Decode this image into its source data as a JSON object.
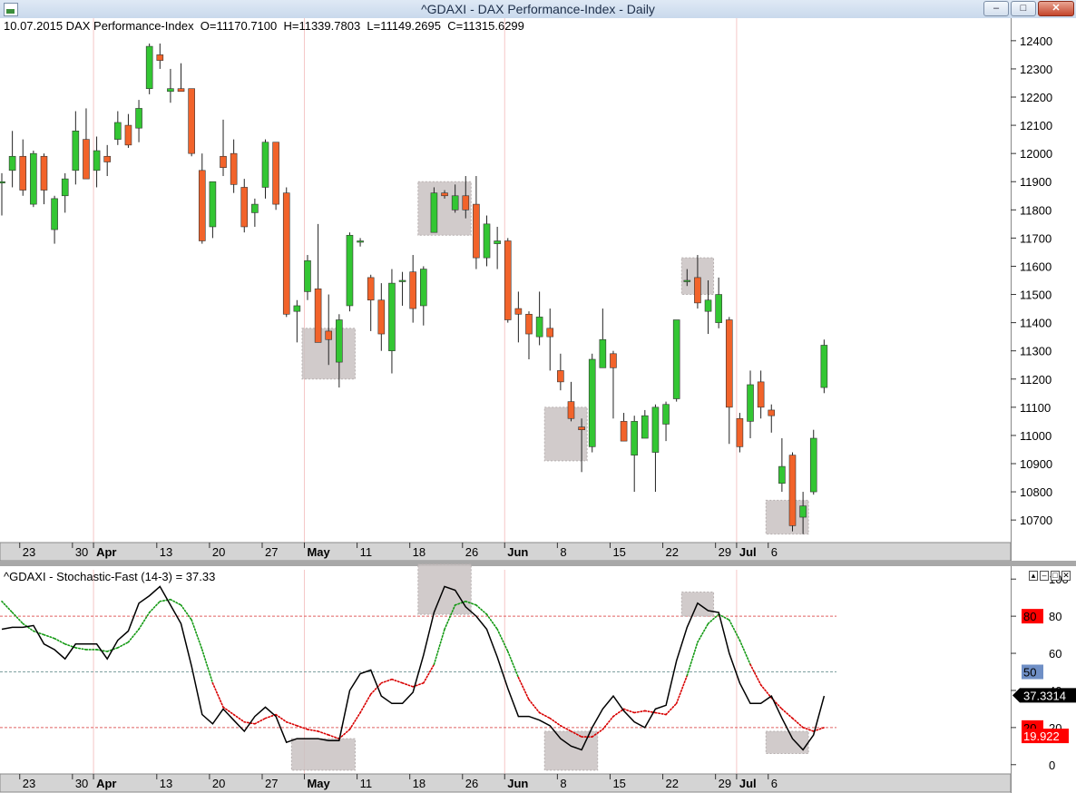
{
  "window": {
    "title": "^GDAXI - DAX Performance-Index - Daily",
    "minimize_glyph": "–",
    "maximize_glyph": "□",
    "close_glyph": "✕"
  },
  "price_panel": {
    "info": "10.07.2015 DAX Performance-Index  O=11170.7100  H=11339.7803  L=11149.2695  C=11315.6299"
  },
  "stoch_panel": {
    "info": "^GDAXI - Stochastic-Fast (14-3) = 37.33",
    "controls": [
      "▴",
      "–",
      "□",
      "✕"
    ]
  },
  "colors": {
    "bull": "#33c633",
    "bear": "#f2632a",
    "wick": "#222222",
    "k_line": "#000000",
    "d_line_green": "#139913",
    "d_line_red": "#d80000",
    "highlight": "#c9c2c2",
    "overbought_badge": "#ff0000",
    "midline_badge": "#6f8fc6",
    "current_badge": "#000000"
  },
  "chart_data": [
    {
      "type": "candlestick",
      "title": "^GDAXI - DAX Performance-Index - Daily",
      "ylim": [
        10620,
        12480
      ],
      "yticks": [
        10700,
        10800,
        10900,
        11000,
        11100,
        11200,
        11300,
        11400,
        11500,
        11600,
        11700,
        11800,
        11900,
        12000,
        12100,
        12200,
        12300,
        12400
      ],
      "x_tick_labels": [
        {
          "label": "23",
          "index": 2,
          "bold": false
        },
        {
          "label": "30",
          "index": 7,
          "bold": false
        },
        {
          "label": "Apr",
          "index": 9,
          "bold": true
        },
        {
          "label": "13",
          "index": 15,
          "bold": false
        },
        {
          "label": "20",
          "index": 20,
          "bold": false
        },
        {
          "label": "27",
          "index": 25,
          "bold": false
        },
        {
          "label": "May",
          "index": 29,
          "bold": true
        },
        {
          "label": "11",
          "index": 34,
          "bold": false
        },
        {
          "label": "18",
          "index": 39,
          "bold": false
        },
        {
          "label": "26",
          "index": 44,
          "bold": false
        },
        {
          "label": "Jun",
          "index": 48,
          "bold": true
        },
        {
          "label": "8",
          "index": 53,
          "bold": false
        },
        {
          "label": "15",
          "index": 58,
          "bold": false
        },
        {
          "label": "22",
          "index": 63,
          "bold": false
        },
        {
          "label": "29",
          "index": 68,
          "bold": false
        },
        {
          "label": "Jul",
          "index": 70,
          "bold": true
        },
        {
          "label": "6",
          "index": 73,
          "bold": false
        }
      ],
      "month_separators": [
        9,
        29,
        48,
        70
      ],
      "candles": [
        [
          11900,
          11930,
          11780,
          11900
        ],
        [
          11940,
          12080,
          11880,
          11990
        ],
        [
          11990,
          12050,
          11850,
          11870
        ],
        [
          11820,
          12010,
          11810,
          12000
        ],
        [
          11990,
          12000,
          11820,
          11870
        ],
        [
          11730,
          11850,
          11680,
          11840
        ],
        [
          11850,
          11930,
          11790,
          11910
        ],
        [
          11940,
          12150,
          11890,
          12080
        ],
        [
          12050,
          12160,
          11940,
          11910
        ],
        [
          11940,
          12060,
          11880,
          12010
        ],
        [
          11990,
          12030,
          11920,
          11970
        ],
        [
          12050,
          12150,
          12030,
          12110
        ],
        [
          12100,
          12140,
          12020,
          12030
        ],
        [
          12090,
          12190,
          12040,
          12160
        ],
        [
          12230,
          12390,
          12210,
          12380
        ],
        [
          12350,
          12390,
          12300,
          12330
        ],
        [
          12220,
          12300,
          12180,
          12230
        ],
        [
          12230,
          12320,
          12220,
          12220
        ],
        [
          12230,
          12230,
          11990,
          12000
        ],
        [
          11940,
          12000,
          11680,
          11690
        ],
        [
          11740,
          11900,
          11700,
          11900
        ],
        [
          11990,
          12120,
          11920,
          11950
        ],
        [
          12000,
          12050,
          11860,
          11890
        ],
        [
          11880,
          11910,
          11720,
          11740
        ],
        [
          11790,
          11840,
          11740,
          11820
        ],
        [
          11880,
          12050,
          11840,
          12040
        ],
        [
          12040,
          12040,
          11800,
          11820
        ],
        [
          11860,
          11880,
          11420,
          11430
        ],
        [
          11440,
          11480,
          11330,
          11460
        ],
        [
          11510,
          11640,
          11480,
          11620
        ],
        [
          11520,
          11750,
          11330,
          11330
        ],
        [
          11370,
          11500,
          11250,
          11340
        ],
        [
          11260,
          11430,
          11170,
          11410
        ],
        [
          11460,
          11720,
          11440,
          11710
        ],
        [
          11690,
          11700,
          11670,
          11690
        ],
        [
          11560,
          11570,
          11370,
          11480
        ],
        [
          11480,
          11540,
          11300,
          11360
        ],
        [
          11300,
          11590,
          11220,
          11540
        ],
        [
          11550,
          11580,
          11460,
          11550
        ],
        [
          11580,
          11640,
          11400,
          11450
        ],
        [
          11460,
          11600,
          11390,
          11590
        ],
        [
          11720,
          11880,
          11720,
          11860
        ],
        [
          11860,
          11870,
          11840,
          11850
        ],
        [
          11800,
          11890,
          11790,
          11850
        ],
        [
          11850,
          11920,
          11770,
          11800
        ],
        [
          11820,
          11920,
          11590,
          11630
        ],
        [
          11630,
          11780,
          11600,
          11750
        ],
        [
          11680,
          11740,
          11590,
          11690
        ],
        [
          11690,
          11700,
          11400,
          11410
        ],
        [
          11450,
          11510,
          11330,
          11430
        ],
        [
          11430,
          11440,
          11270,
          11360
        ],
        [
          11350,
          11510,
          11320,
          11420
        ],
        [
          11380,
          11450,
          11230,
          11350
        ],
        [
          11230,
          11290,
          11160,
          11190
        ],
        [
          11120,
          11190,
          11050,
          11060
        ],
        [
          11030,
          11060,
          10870,
          11020
        ],
        [
          10960,
          11290,
          10940,
          11270
        ],
        [
          11240,
          11450,
          11240,
          11340
        ],
        [
          11290,
          11300,
          11060,
          11240
        ],
        [
          11050,
          11080,
          10980,
          10980
        ],
        [
          10930,
          11070,
          10800,
          11050
        ],
        [
          10990,
          11090,
          10990,
          11070
        ],
        [
          10940,
          11110,
          10800,
          11100
        ],
        [
          11040,
          11120,
          10980,
          11110
        ],
        [
          11130,
          11260,
          11120,
          11410
        ],
        [
          11550,
          11590,
          11530,
          11550
        ],
        [
          11560,
          11640,
          11450,
          11470
        ],
        [
          11440,
          11550,
          11360,
          11480
        ],
        [
          11400,
          11560,
          11380,
          11500
        ],
        [
          11410,
          11420,
          10970,
          11100
        ],
        [
          11060,
          11080,
          10940,
          10960
        ],
        [
          11050,
          11230,
          10990,
          11180
        ],
        [
          11190,
          11230,
          11060,
          11100
        ],
        [
          11090,
          11110,
          11010,
          11070
        ],
        [
          10830,
          10990,
          10800,
          10890
        ],
        [
          10930,
          10940,
          10660,
          10680
        ],
        [
          10710,
          10800,
          10650,
          10750
        ],
        [
          10800,
          11020,
          10790,
          10990
        ],
        [
          11170,
          11340,
          11150,
          11320
        ]
      ],
      "highlight_boxes": [
        {
          "i0": 29,
          "i1": 33,
          "p_high": 11380,
          "p_low": 11200
        },
        {
          "i0": 40,
          "i1": 44,
          "p_high": 11900,
          "p_low": 11710
        },
        {
          "i0": 52,
          "i1": 55,
          "p_high": 11100,
          "p_low": 10910
        },
        {
          "i0": 65,
          "i1": 67,
          "p_high": 11630,
          "p_low": 11500
        },
        {
          "i0": 73,
          "i1": 76,
          "p_high": 10770,
          "p_low": 10650
        }
      ]
    },
    {
      "type": "line",
      "title": "^GDAXI - Stochastic-Fast (14-3) = 37.33",
      "ylim": [
        -5,
        105
      ],
      "yticks": [
        0,
        20,
        40,
        60,
        80,
        100
      ],
      "levels": [
        80,
        50,
        20
      ],
      "level_badges": [
        {
          "value": 80,
          "label": "80",
          "color": "#ff0000"
        },
        {
          "value": 50,
          "label": "50",
          "color": "#6f8fc6"
        },
        {
          "value": 20,
          "label": "20",
          "color": "#ff0000"
        },
        {
          "value": 15.5,
          "label": "19.922",
          "color": "#ff0000"
        }
      ],
      "current": {
        "value": 37.33,
        "label": "37.3314"
      },
      "series": [
        {
          "name": "%K",
          "style": "solid",
          "values": [
            73,
            74,
            74,
            75,
            65,
            62,
            57,
            65,
            65,
            65,
            57,
            67,
            72,
            87,
            91,
            96,
            86,
            76,
            53,
            27,
            22,
            30,
            24,
            18,
            26,
            31,
            26,
            12,
            14,
            14,
            14,
            13,
            13,
            40,
            49,
            51,
            37,
            33,
            33,
            39,
            59,
            82,
            96,
            94,
            85,
            80,
            73,
            58,
            41,
            26,
            26,
            24,
            21,
            14,
            10,
            8,
            20,
            30,
            37,
            29,
            23,
            20,
            30,
            32,
            56,
            74,
            87,
            83,
            82,
            60,
            44,
            33,
            33,
            37,
            25,
            14,
            8,
            16,
            37
          ]
        },
        {
          "name": "%D",
          "style": "dotted",
          "values": [
            88,
            82,
            76,
            72,
            70,
            68,
            65,
            63,
            62,
            62,
            61,
            63,
            66,
            73,
            82,
            88,
            89,
            86,
            78,
            62,
            44,
            31,
            27,
            23,
            22,
            25,
            27,
            23,
            21,
            19,
            18,
            16,
            14,
            19,
            28,
            38,
            44,
            46,
            44,
            42,
            44,
            54,
            73,
            86,
            88,
            86,
            81,
            73,
            61,
            47,
            35,
            28,
            25,
            21,
            18,
            15,
            15,
            19,
            26,
            30,
            28,
            29,
            28,
            27,
            33,
            48,
            66,
            76,
            81,
            78,
            67,
            54,
            43,
            36,
            30,
            25,
            20,
            18,
            20
          ]
        }
      ]
    }
  ]
}
